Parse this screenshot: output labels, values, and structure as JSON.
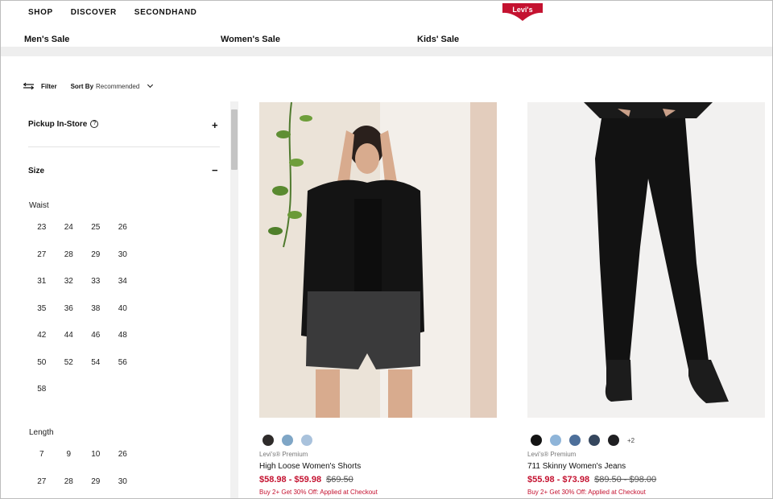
{
  "nav": {
    "items": [
      "SHOP",
      "DISCOVER",
      "SECONDHAND"
    ],
    "logo_text": "Levi's"
  },
  "categories": [
    "Men's Sale",
    "Women's Sale",
    "Kids' Sale"
  ],
  "toolbar": {
    "filter_label": "Filter",
    "sort_label": "Sort By",
    "sort_value": "Recommended"
  },
  "sidebar": {
    "pickup": {
      "title": "Pickup In-Store",
      "info_glyph": "?",
      "toggle": "+"
    },
    "size": {
      "title": "Size",
      "toggle": "−",
      "waist_label": "Waist",
      "waist": [
        "23",
        "24",
        "25",
        "26",
        "27",
        "28",
        "29",
        "30",
        "31",
        "32",
        "33",
        "34",
        "35",
        "36",
        "38",
        "40",
        "42",
        "44",
        "46",
        "48",
        "50",
        "52",
        "54",
        "56",
        "58"
      ],
      "length_label": "Length",
      "length": [
        "7",
        "9",
        "10",
        "26",
        "27",
        "28",
        "29",
        "30"
      ]
    }
  },
  "products": [
    {
      "brand": "Levi's® Premium",
      "name": "High Loose Women's Shorts",
      "sale_price": "$58.98 - $59.98",
      "orig_price": "$69.50",
      "promo": "Buy 2+ Get 30% Off: Applied at Checkout",
      "swatches": [
        "#2e2b2a",
        "#7fa6c6",
        "#a9c2dc"
      ],
      "more": ""
    },
    {
      "brand": "Levi's® Premium",
      "name": "711 Skinny Women's Jeans",
      "sale_price": "$55.98 - $73.98",
      "orig_price": "$89.50 - $98.00",
      "promo": "Buy 2+ Get 30% Off: Applied at Checkout",
      "swatches": [
        "#141414",
        "#8fb5d9",
        "#4d6f9a",
        "#36475e",
        "#1f1f22"
      ],
      "more": "+2"
    }
  ],
  "colors": {
    "sale_red": "#c41230",
    "logo_red": "#c41230"
  }
}
